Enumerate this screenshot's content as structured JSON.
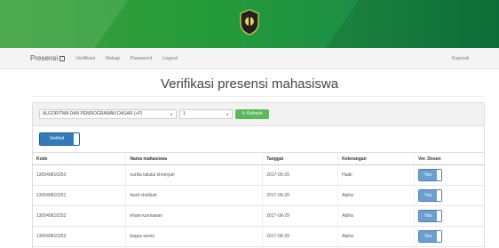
{
  "navbar": {
    "brand": "Presensi",
    "links": [
      "Verifikasi",
      "Rekap",
      "Password",
      "Logout"
    ],
    "right_link": "Kaprodi"
  },
  "page": {
    "title": "Verifikasi presensi mahasiswa"
  },
  "filters": {
    "course": "ALGORITMA DAN PEMROGRAMAN DASAR (+P)",
    "meeting": "1",
    "refresh_label": "Refresh"
  },
  "toggle": {
    "label": "Verified"
  },
  "table": {
    "headers": [
      "Kode",
      "Nama mahasiswa",
      "Tanggal",
      "Keterangan",
      "Ver. Dosen"
    ],
    "rows": [
      {
        "kode": "130549810250",
        "nama": "nurilla lailatul khoiriyah",
        "tanggal": "2017-09-29",
        "keterangan": "Hadir",
        "ver": "Yes"
      },
      {
        "kode": "130549810251",
        "nama": "hesti sholikah",
        "tanggal": "2017-09-29",
        "keterangan": "Alpha",
        "ver": "Yes"
      },
      {
        "kode": "130549810252",
        "nama": "irham kurniawan",
        "tanggal": "2017-09-29",
        "keterangan": "Alpha",
        "ver": "Yes"
      },
      {
        "kode": "130549810253",
        "nama": "bagus wisnu",
        "tanggal": "2017-09-29",
        "keterangan": "Alpha",
        "ver": "Yes"
      }
    ]
  },
  "colors": {
    "banner": "#249a3a",
    "primary": "#337ab7",
    "success": "#5cb85c"
  },
  "icons": {
    "logo": "university-logo",
    "brand": "presensi-icon",
    "refresh": "refresh-icon"
  }
}
